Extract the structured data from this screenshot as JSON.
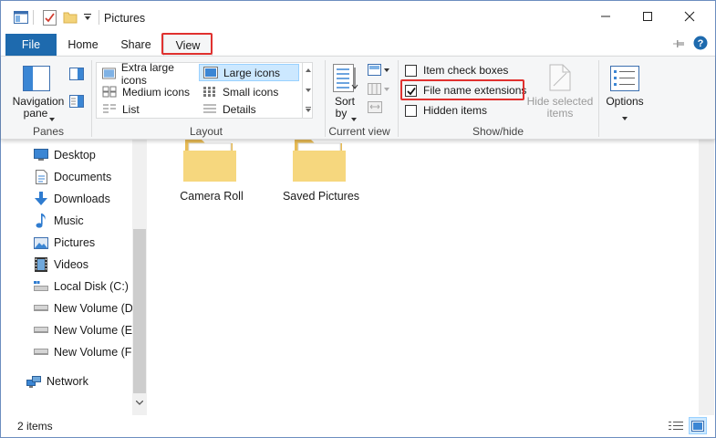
{
  "window": {
    "title": "Pictures",
    "controls": {
      "minimize": "—",
      "maximize": "☐",
      "close": "✕"
    }
  },
  "tabs": {
    "file": "File",
    "home": "Home",
    "share": "Share",
    "view": "View"
  },
  "ribbon": {
    "panes": {
      "navigation_pane": "Navigation",
      "navigation_pane_2": "pane",
      "group": "Panes"
    },
    "layout": {
      "group": "Layout",
      "items": [
        {
          "label": "Extra large icons"
        },
        {
          "label": "Large icons",
          "selected": true
        },
        {
          "label": "Medium icons"
        },
        {
          "label": "Small icons"
        },
        {
          "label": "List"
        },
        {
          "label": "Details"
        }
      ]
    },
    "current_view": {
      "sort_by": "Sort",
      "sort_by_2": "by",
      "group": "Current view"
    },
    "show_hide": {
      "item_check_boxes": "Item check boxes",
      "file_name_extensions": "File name extensions",
      "hidden_items": "Hidden items",
      "hide_selected_1": "Hide selected",
      "hide_selected_2": "items",
      "group": "Show/hide",
      "checks": {
        "item_check_boxes": false,
        "file_name_extensions": true,
        "hidden_items": false
      }
    },
    "options": "Options"
  },
  "nav": {
    "items": [
      {
        "label": "Desktop",
        "icon": "desktop-icon"
      },
      {
        "label": "Documents",
        "icon": "documents-icon"
      },
      {
        "label": "Downloads",
        "icon": "downloads-icon"
      },
      {
        "label": "Music",
        "icon": "music-icon"
      },
      {
        "label": "Pictures",
        "icon": "pictures-icon"
      },
      {
        "label": "Videos",
        "icon": "videos-icon"
      },
      {
        "label": "Local Disk (C:)",
        "icon": "local-disk-icon"
      },
      {
        "label": "New Volume (D:",
        "icon": "drive-icon"
      },
      {
        "label": "New Volume (E:)",
        "icon": "drive-icon"
      },
      {
        "label": "New Volume (F:)",
        "icon": "drive-icon"
      }
    ],
    "network": "Network"
  },
  "content": {
    "folders": [
      {
        "label": "Camera Roll"
      },
      {
        "label": "Saved Pictures"
      }
    ]
  },
  "status": {
    "items_count": "2 items"
  },
  "colors": {
    "file_tab": "#1e6aae",
    "highlight": "#e0312f",
    "folder": "#f3d37a",
    "selection": "#cce8ff"
  }
}
